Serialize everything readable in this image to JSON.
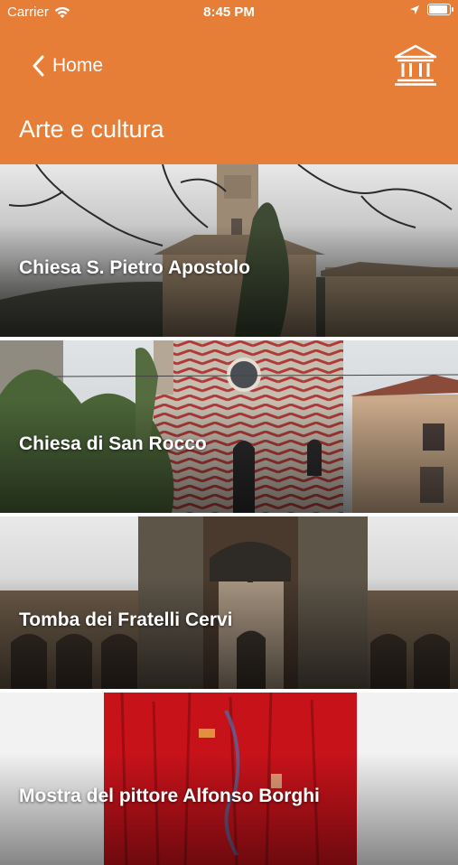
{
  "status_bar": {
    "carrier": "Carrier",
    "time": "8:45 PM"
  },
  "nav": {
    "back_label": "Home"
  },
  "page": {
    "title": "Arte e cultura"
  },
  "items": [
    {
      "label": "Chiesa S. Pietro Apostolo"
    },
    {
      "label": "Chiesa di San Rocco"
    },
    {
      "label": "Tomba dei Fratelli Cervi"
    },
    {
      "label": "Mostra del pittore Alfonso Borghi"
    }
  ],
  "colors": {
    "accent": "#e67e37",
    "text_on_accent": "#ffffff"
  },
  "icons": {
    "signal": "wifi-icon",
    "location": "location-arrow-icon",
    "battery": "battery-icon",
    "back": "chevron-left-icon",
    "museum": "museum-icon"
  }
}
